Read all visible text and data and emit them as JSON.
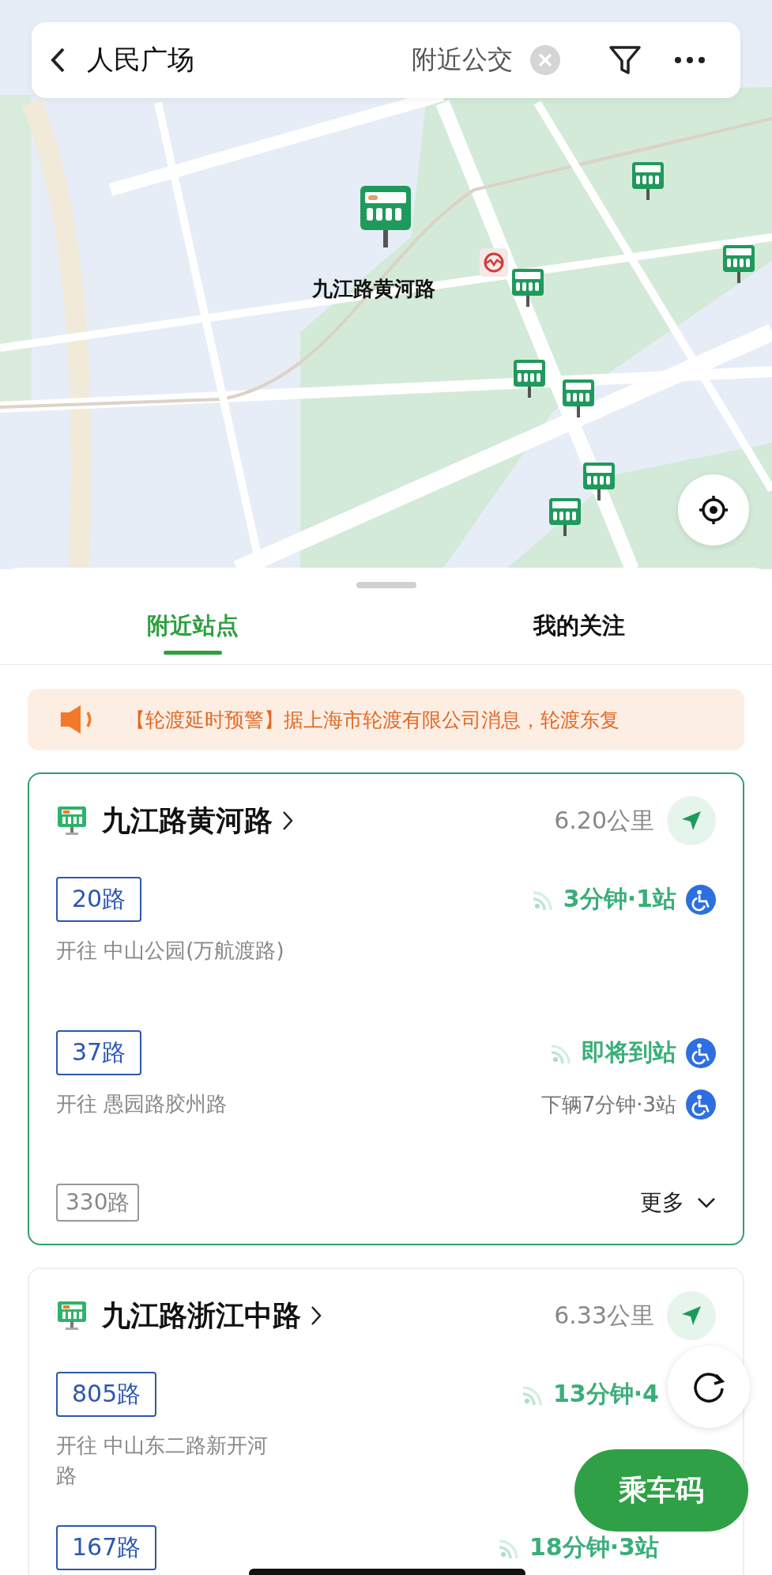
{
  "header": {
    "title": "人民广场",
    "chip": "附近公交"
  },
  "map": {
    "kind": "picture",
    "stop_label": "九江路黄河路"
  },
  "tabs": [
    {
      "label": "附近站点",
      "selected": true
    },
    {
      "label": "我的关注",
      "selected": false
    }
  ],
  "notice": "【轮渡延时预警】据上海市轮渡有限公司消息，轮渡东复",
  "stations": [
    {
      "name": "九江路黄河路",
      "distance": "6.20公里",
      "selected": true,
      "more": "更多",
      "routes": [
        {
          "kind": "live",
          "route": "20路",
          "destination": "开往 中山公园(万航渡路)",
          "arrival": "3分钟·1站",
          "accessible": true
        },
        {
          "kind": "live",
          "route": "37路",
          "destination": "开往 愚园路胶州路",
          "arrival": "即将到站",
          "accessible": true,
          "next": "下辆7分钟·3站",
          "next_accessible": true
        },
        {
          "kind": "idle",
          "route": "330路"
        }
      ]
    },
    {
      "name": "九江路浙江中路",
      "distance": "6.33公里",
      "selected": false,
      "routes": [
        {
          "kind": "live",
          "route": "805路",
          "destination": "开往 中山东二路新开河路",
          "arrival": "13分钟·4"
        },
        {
          "kind": "live",
          "route": "167路",
          "arrival": "18分钟·3站"
        }
      ]
    }
  ],
  "ride_button": "乘车码"
}
